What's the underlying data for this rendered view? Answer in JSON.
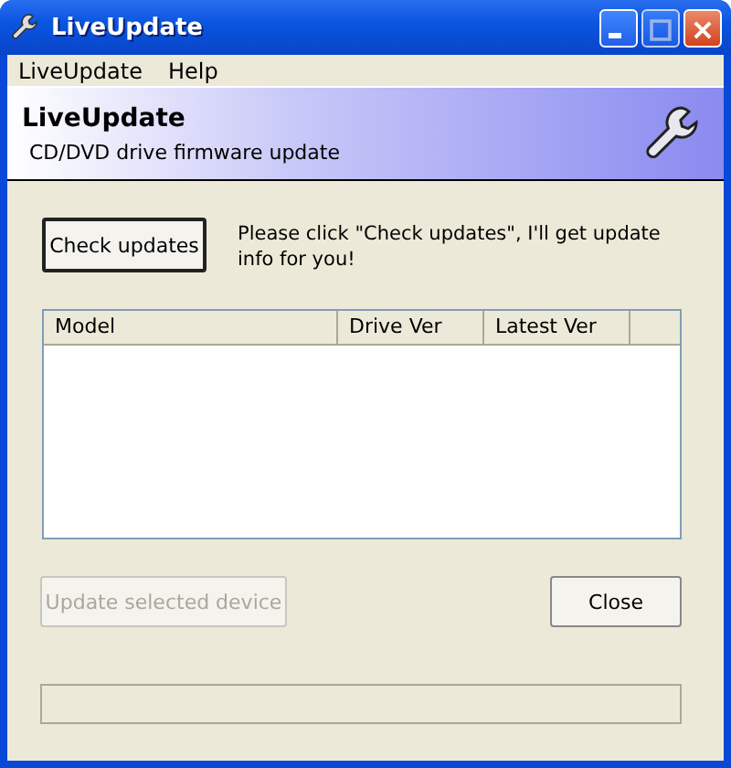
{
  "window": {
    "title": "LiveUpdate"
  },
  "menu": [
    {
      "label": "LiveUpdate"
    },
    {
      "label": "Help"
    }
  ],
  "header": {
    "title": "LiveUpdate",
    "subtitle": "CD/DVD drive firmware update"
  },
  "check_button": {
    "label": "Check updates",
    "default": true
  },
  "message": "Please click \"Check updates\", I'll get update info for you!",
  "table": {
    "columns": [
      "Model",
      "Drive Ver",
      "Latest Ver"
    ]
  },
  "buttons": [
    {
      "label": "Update selected device",
      "disabled": true
    },
    {
      "label": "Close",
      "disabled": false
    }
  ]
}
